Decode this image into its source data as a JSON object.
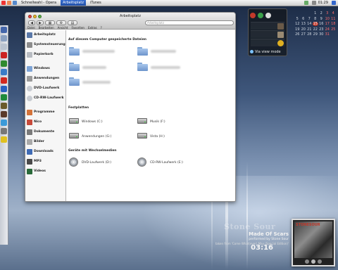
{
  "taskbar": {
    "tasks": [
      {
        "label": "Schnellwahl - Opera",
        "active": false
      },
      {
        "label": "Arbeitsplatz",
        "active": true
      },
      {
        "label": "iTunes",
        "active": false
      }
    ],
    "clock": "01:29"
  },
  "window": {
    "title": "Arbeitsplatz",
    "address": "Arbeitsplatz",
    "menu": [
      "Datei",
      "Bearbeiten",
      "Ansicht",
      "Favoriten",
      "Extras",
      "?"
    ],
    "sidebar": [
      {
        "label": "Arbeitsplatz",
        "icon": "computer-icon"
      },
      {
        "label": "Systemsteuerung",
        "icon": "control-panel-icon"
      },
      {
        "label": "Papierkorb",
        "icon": "trash-icon"
      },
      {
        "label": "Windows",
        "icon": "windows-folder-icon"
      },
      {
        "label": "Anwendungen",
        "icon": "applications-icon"
      },
      {
        "label": "DVD-Laufwerk",
        "icon": "dvd-drive-icon"
      },
      {
        "label": "CD-RW-Laufwerk",
        "icon": "cd-drive-icon"
      },
      {
        "label": "Programme",
        "icon": "programs-icon"
      },
      {
        "label": "Nico",
        "icon": "user-folder-icon"
      },
      {
        "label": "Dokumente",
        "icon": "documents-icon"
      },
      {
        "label": "Bilder",
        "icon": "pictures-icon"
      },
      {
        "label": "Downloads",
        "icon": "downloads-icon"
      },
      {
        "label": "MP3",
        "icon": "music-icon"
      },
      {
        "label": "Videos",
        "icon": "videos-icon"
      }
    ],
    "sections": {
      "shared": "Auf diesem Computer gespeicherte Dateien",
      "disks": "Festplatten",
      "removable": "Geräte mit Wechselmedien"
    },
    "disks": [
      "Windows (C:)",
      "Musik (F:)",
      "Anwendungen (G:)",
      "Vista (H:)"
    ],
    "removable": [
      "DVD-Laufwerk (D:)",
      "CD-RW-Laufwerk (E:)"
    ]
  },
  "buddy": {
    "status": "Via view mode"
  },
  "calendar": {
    "days": [
      "",
      "",
      "",
      "1",
      "2",
      "3",
      "4",
      "5",
      "6",
      "7",
      "8",
      "9",
      "10",
      "11",
      "12",
      "13",
      "14",
      "15",
      "16",
      "17",
      "18",
      "19",
      "20",
      "21",
      "22",
      "23",
      "24",
      "25",
      "26",
      "27",
      "28",
      "29",
      "30",
      "31",
      ""
    ],
    "today": "15"
  },
  "now_playing": {
    "artist": "Stone Sour",
    "song": "Made Of Scars",
    "performed": "performed by Stone Sour",
    "album": "taken from 'Come What(ever) May (Special Edition)'",
    "time": "03:16",
    "cover_title": "STONESOUR"
  }
}
